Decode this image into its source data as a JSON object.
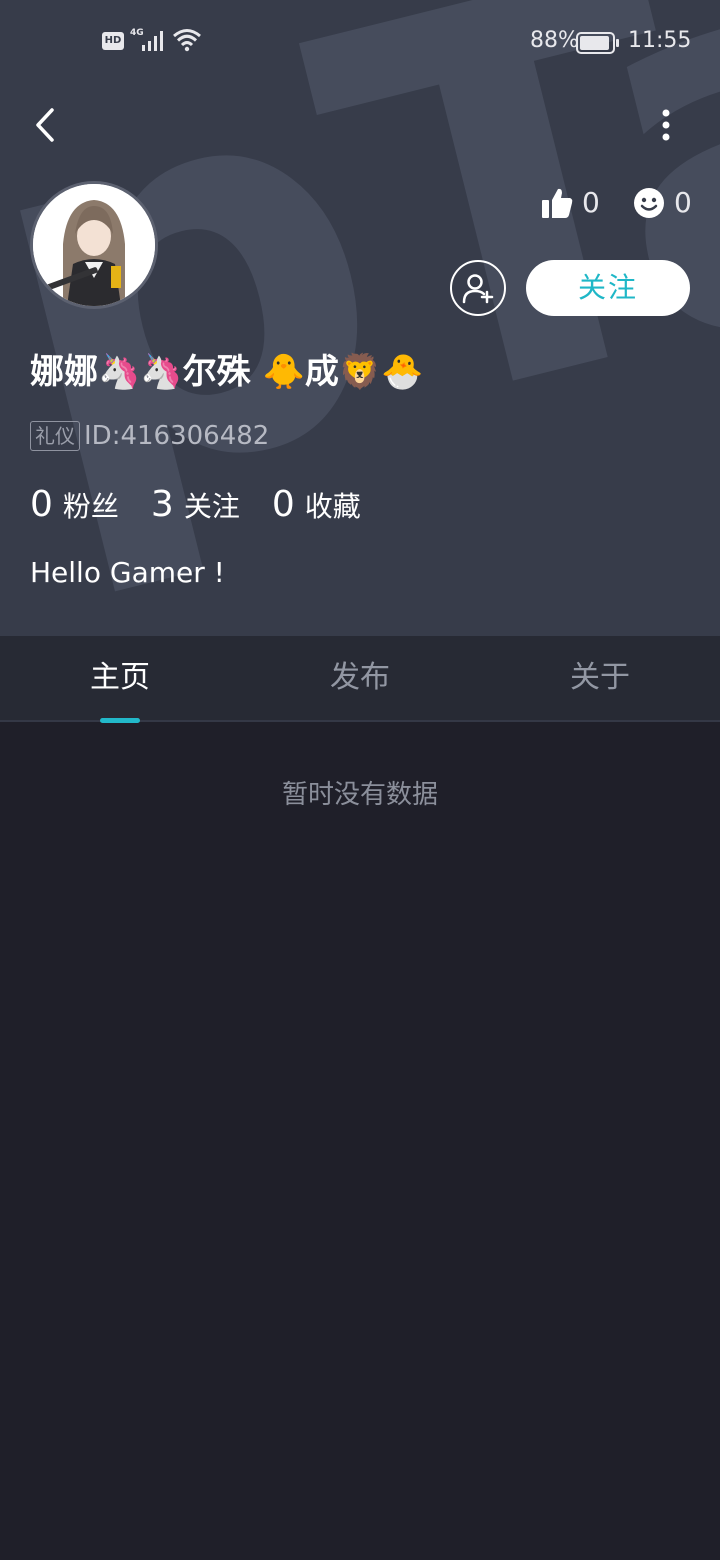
{
  "status_bar": {
    "hd_label": "HD",
    "network_label": "4G",
    "battery_percent": "88%",
    "time": "11:55"
  },
  "nav": {
    "back_icon": "chevron-left-icon",
    "more_icon": "more-vertical-icon"
  },
  "watermark": "pTa",
  "profile": {
    "avatar_icon": "avatar-anime-girl",
    "likes_count": "0",
    "reactions_count": "0",
    "follow_label": "关注",
    "name": "娜娜🦄🦄尔殊   🐥成🦁🐣",
    "role_badge": "礼仪",
    "id_text": "ID:416306482",
    "bio": "Hello Gamer !"
  },
  "stats": [
    {
      "value": "0",
      "label": "粉丝"
    },
    {
      "value": "3",
      "label": "关注"
    },
    {
      "value": "0",
      "label": "收藏"
    }
  ],
  "tabs": [
    {
      "label": "主页",
      "active": true
    },
    {
      "label": "发布",
      "active": false
    },
    {
      "label": "关于",
      "active": false
    }
  ],
  "empty_message": "暂时没有数据",
  "colors": {
    "header_bg": "#373c4a",
    "page_bg": "#1f1f29",
    "accent": "#22b8c9"
  }
}
